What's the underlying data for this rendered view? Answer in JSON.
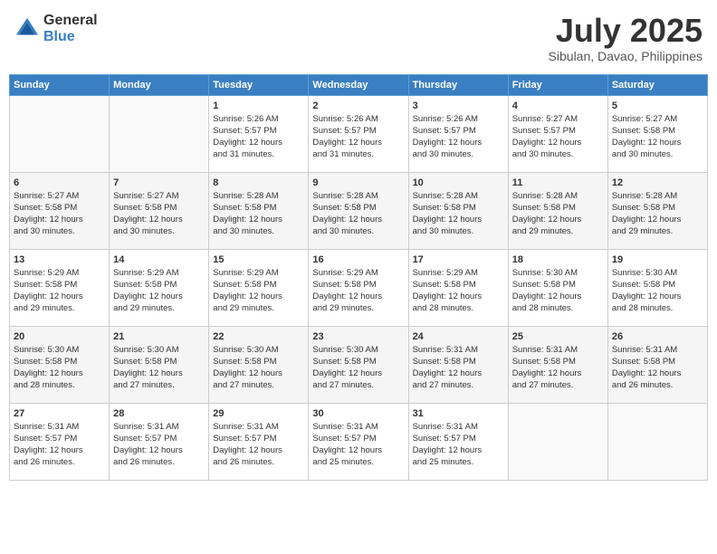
{
  "header": {
    "logo_line1": "General",
    "logo_line2": "Blue",
    "month_year": "July 2025",
    "location": "Sibulan, Davao, Philippines"
  },
  "days_of_week": [
    "Sunday",
    "Monday",
    "Tuesday",
    "Wednesday",
    "Thursday",
    "Friday",
    "Saturday"
  ],
  "weeks": [
    [
      {
        "day": "",
        "info": ""
      },
      {
        "day": "",
        "info": ""
      },
      {
        "day": "1",
        "info": "Sunrise: 5:26 AM\nSunset: 5:57 PM\nDaylight: 12 hours\nand 31 minutes."
      },
      {
        "day": "2",
        "info": "Sunrise: 5:26 AM\nSunset: 5:57 PM\nDaylight: 12 hours\nand 31 minutes."
      },
      {
        "day": "3",
        "info": "Sunrise: 5:26 AM\nSunset: 5:57 PM\nDaylight: 12 hours\nand 30 minutes."
      },
      {
        "day": "4",
        "info": "Sunrise: 5:27 AM\nSunset: 5:57 PM\nDaylight: 12 hours\nand 30 minutes."
      },
      {
        "day": "5",
        "info": "Sunrise: 5:27 AM\nSunset: 5:58 PM\nDaylight: 12 hours\nand 30 minutes."
      }
    ],
    [
      {
        "day": "6",
        "info": "Sunrise: 5:27 AM\nSunset: 5:58 PM\nDaylight: 12 hours\nand 30 minutes."
      },
      {
        "day": "7",
        "info": "Sunrise: 5:27 AM\nSunset: 5:58 PM\nDaylight: 12 hours\nand 30 minutes."
      },
      {
        "day": "8",
        "info": "Sunrise: 5:28 AM\nSunset: 5:58 PM\nDaylight: 12 hours\nand 30 minutes."
      },
      {
        "day": "9",
        "info": "Sunrise: 5:28 AM\nSunset: 5:58 PM\nDaylight: 12 hours\nand 30 minutes."
      },
      {
        "day": "10",
        "info": "Sunrise: 5:28 AM\nSunset: 5:58 PM\nDaylight: 12 hours\nand 30 minutes."
      },
      {
        "day": "11",
        "info": "Sunrise: 5:28 AM\nSunset: 5:58 PM\nDaylight: 12 hours\nand 29 minutes."
      },
      {
        "day": "12",
        "info": "Sunrise: 5:28 AM\nSunset: 5:58 PM\nDaylight: 12 hours\nand 29 minutes."
      }
    ],
    [
      {
        "day": "13",
        "info": "Sunrise: 5:29 AM\nSunset: 5:58 PM\nDaylight: 12 hours\nand 29 minutes."
      },
      {
        "day": "14",
        "info": "Sunrise: 5:29 AM\nSunset: 5:58 PM\nDaylight: 12 hours\nand 29 minutes."
      },
      {
        "day": "15",
        "info": "Sunrise: 5:29 AM\nSunset: 5:58 PM\nDaylight: 12 hours\nand 29 minutes."
      },
      {
        "day": "16",
        "info": "Sunrise: 5:29 AM\nSunset: 5:58 PM\nDaylight: 12 hours\nand 29 minutes."
      },
      {
        "day": "17",
        "info": "Sunrise: 5:29 AM\nSunset: 5:58 PM\nDaylight: 12 hours\nand 28 minutes."
      },
      {
        "day": "18",
        "info": "Sunrise: 5:30 AM\nSunset: 5:58 PM\nDaylight: 12 hours\nand 28 minutes."
      },
      {
        "day": "19",
        "info": "Sunrise: 5:30 AM\nSunset: 5:58 PM\nDaylight: 12 hours\nand 28 minutes."
      }
    ],
    [
      {
        "day": "20",
        "info": "Sunrise: 5:30 AM\nSunset: 5:58 PM\nDaylight: 12 hours\nand 28 minutes."
      },
      {
        "day": "21",
        "info": "Sunrise: 5:30 AM\nSunset: 5:58 PM\nDaylight: 12 hours\nand 27 minutes."
      },
      {
        "day": "22",
        "info": "Sunrise: 5:30 AM\nSunset: 5:58 PM\nDaylight: 12 hours\nand 27 minutes."
      },
      {
        "day": "23",
        "info": "Sunrise: 5:30 AM\nSunset: 5:58 PM\nDaylight: 12 hours\nand 27 minutes."
      },
      {
        "day": "24",
        "info": "Sunrise: 5:31 AM\nSunset: 5:58 PM\nDaylight: 12 hours\nand 27 minutes."
      },
      {
        "day": "25",
        "info": "Sunrise: 5:31 AM\nSunset: 5:58 PM\nDaylight: 12 hours\nand 27 minutes."
      },
      {
        "day": "26",
        "info": "Sunrise: 5:31 AM\nSunset: 5:58 PM\nDaylight: 12 hours\nand 26 minutes."
      }
    ],
    [
      {
        "day": "27",
        "info": "Sunrise: 5:31 AM\nSunset: 5:57 PM\nDaylight: 12 hours\nand 26 minutes."
      },
      {
        "day": "28",
        "info": "Sunrise: 5:31 AM\nSunset: 5:57 PM\nDaylight: 12 hours\nand 26 minutes."
      },
      {
        "day": "29",
        "info": "Sunrise: 5:31 AM\nSunset: 5:57 PM\nDaylight: 12 hours\nand 26 minutes."
      },
      {
        "day": "30",
        "info": "Sunrise: 5:31 AM\nSunset: 5:57 PM\nDaylight: 12 hours\nand 25 minutes."
      },
      {
        "day": "31",
        "info": "Sunrise: 5:31 AM\nSunset: 5:57 PM\nDaylight: 12 hours\nand 25 minutes."
      },
      {
        "day": "",
        "info": ""
      },
      {
        "day": "",
        "info": ""
      }
    ]
  ]
}
